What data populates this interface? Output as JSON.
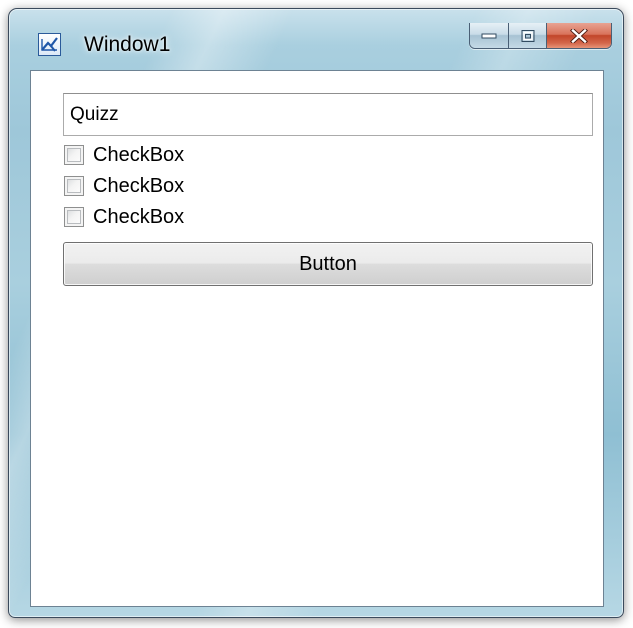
{
  "window": {
    "title": "Window1",
    "app_icon": "wpf-app-icon",
    "caption_buttons": {
      "minimize_icon": "minimize-icon",
      "maximize_icon": "maximize-icon",
      "close_icon": "close-icon",
      "close_color": "#c2452a"
    }
  },
  "content": {
    "textbox": {
      "value": "Quizz"
    },
    "checkboxes": [
      {
        "label": "CheckBox",
        "checked": false
      },
      {
        "label": "CheckBox",
        "checked": false
      },
      {
        "label": "CheckBox",
        "checked": false
      }
    ],
    "button": {
      "label": "Button"
    }
  }
}
